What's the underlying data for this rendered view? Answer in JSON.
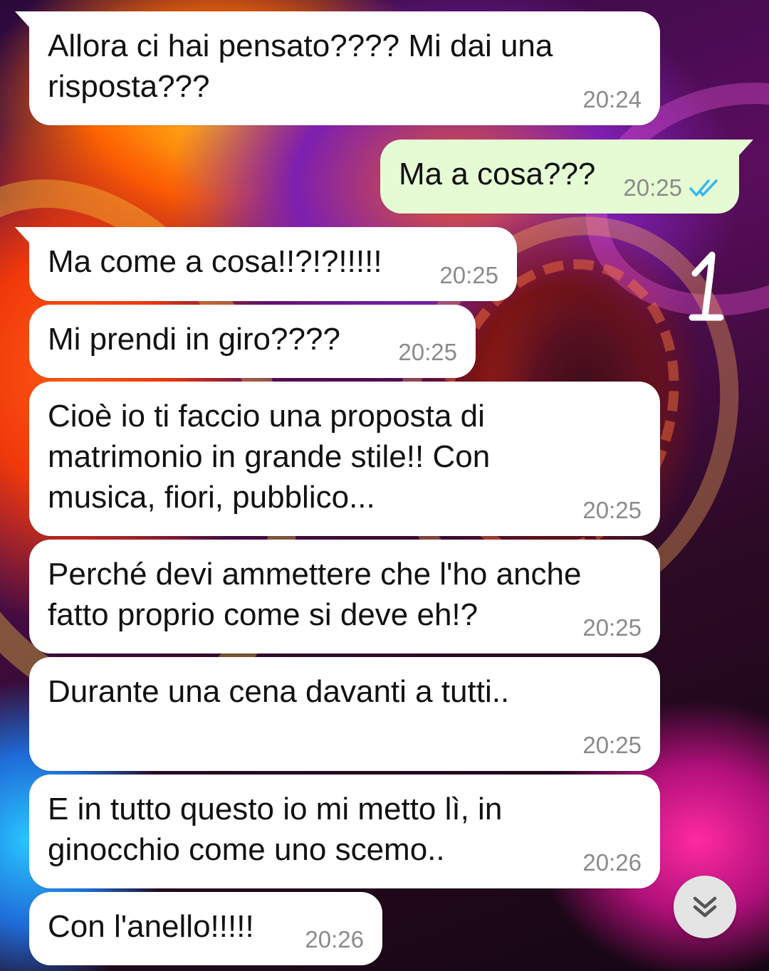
{
  "colors": {
    "incoming_bubble": "#ffffff",
    "outgoing_bubble": "#e5fbd3",
    "timestamp": "#8a8a8a",
    "read_ticks": "#34b7f1"
  },
  "overlay": {
    "hand_mark": "1"
  },
  "messages": [
    {
      "direction": "incoming",
      "text": "Allora ci hai pensato???? Mi dai una\nrisposta???",
      "time": "20:24"
    },
    {
      "direction": "outgoing",
      "text": "Ma a cosa???",
      "time": "20:25",
      "status_icon": "double-check-read-icon"
    },
    {
      "direction": "incoming",
      "text": "Ma come a cosa!!?!?!!!!!",
      "time": "20:25"
    },
    {
      "direction": "incoming",
      "text": "Mi prendi in giro????",
      "time": "20:25"
    },
    {
      "direction": "incoming",
      "text": "Cioè io ti faccio una proposta di\nmatrimonio in grande stile!! Con\nmusica, fiori, pubblico...",
      "time": "20:25"
    },
    {
      "direction": "incoming",
      "text": "Perché devi ammettere che l'ho anche\nfatto proprio come si deve eh!?",
      "time": "20:25"
    },
    {
      "direction": "incoming",
      "text": "Durante una cena davanti a tutti..",
      "time": "20:25"
    },
    {
      "direction": "incoming",
      "text": "E in tutto questo io mi metto lì, in\nginocchio come uno scemo..",
      "time": "20:26"
    },
    {
      "direction": "incoming",
      "text": "Con l'anello!!!!!",
      "time": "20:26"
    }
  ],
  "scroll_button": {
    "icon": "double-chevron-down-icon"
  }
}
